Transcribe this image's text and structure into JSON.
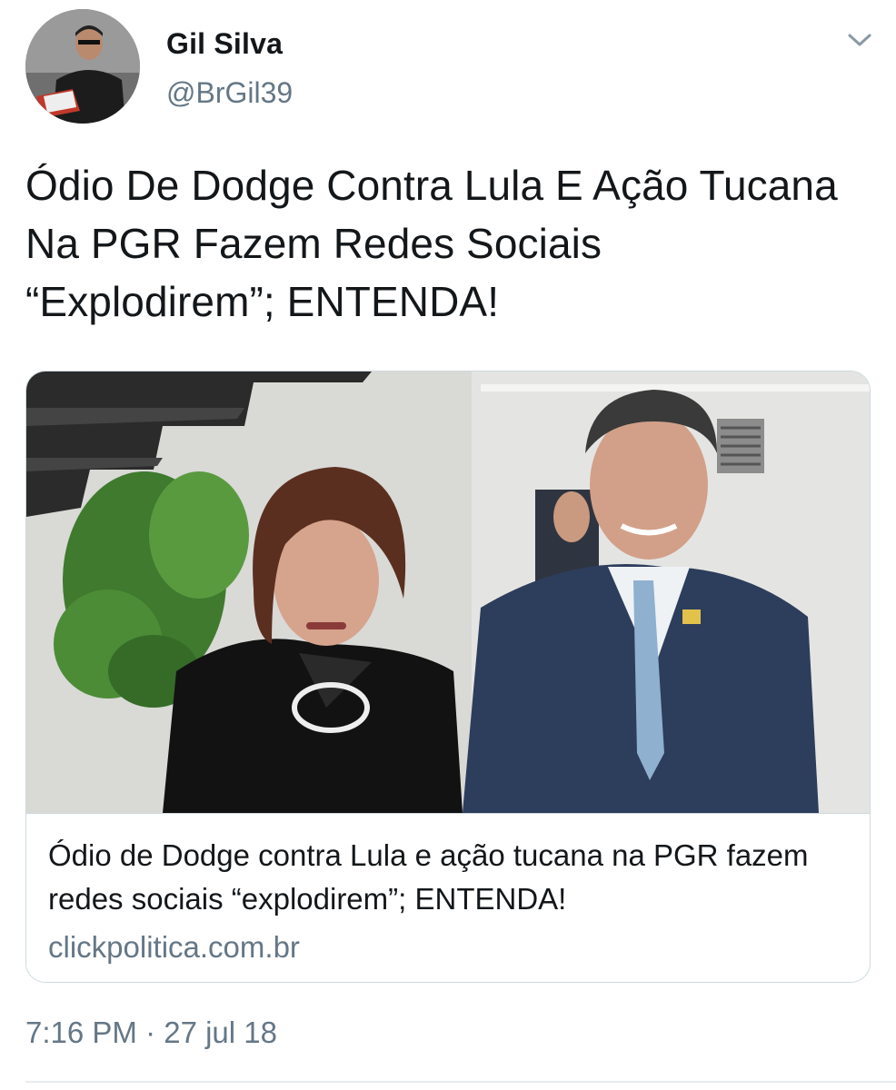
{
  "author": {
    "name": "Gil Silva",
    "handle": "@BrGil39"
  },
  "tweet": {
    "text": "Ódio De Dodge Contra Lula E Ação Tucana Na PGR Fazem Redes Sociais “Explodirem”; ENTENDA!",
    "timestamp": "7:16 PM · 27 jul 18"
  },
  "card": {
    "title": "Ódio de Dodge contra Lula e ação tucana na PGR fazem redes sociais “explodirem”; ENTENDA!",
    "domain": "clickpolitica.com.br"
  },
  "icons": {
    "caret": "chevron-down-icon"
  },
  "colors": {
    "text": "#14171a",
    "secondary": "#657786",
    "border": "#cfd9de"
  }
}
